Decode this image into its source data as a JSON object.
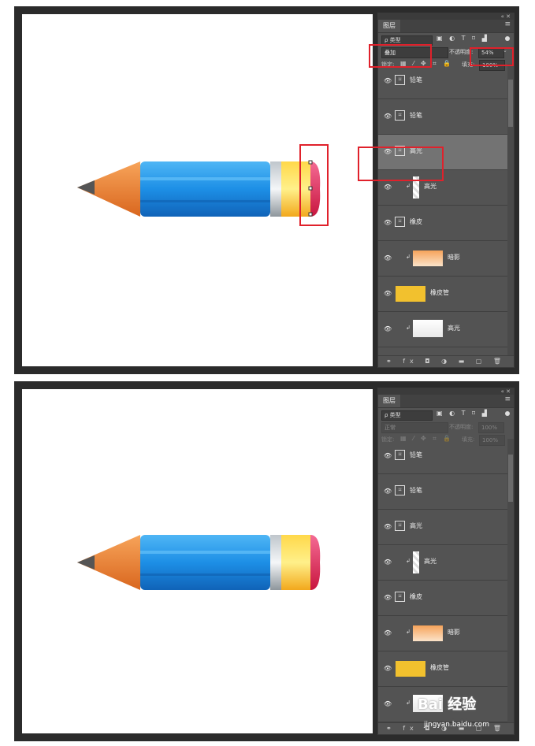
{
  "panel": {
    "tab_label": "图层",
    "filter_label": "ρ 类型",
    "filter_icons": "▣ ◐ T ⌑ ▟",
    "opacity_label": "不透明度:",
    "lock_label": "锁定:",
    "lock_icons": "▦ ⁄ ✥ ⌗ 🔒",
    "fill_label": "填充:",
    "footer_icons": "⚭ fx ◘ ◑ ▬ ▢ 🗑"
  },
  "top": {
    "blend_mode": "叠加",
    "opacity": "54%",
    "fill": "100%",
    "layers": [
      {
        "name": "铅笔",
        "kind": "group"
      },
      {
        "name": "铅笔",
        "kind": "group"
      },
      {
        "name": "高光",
        "kind": "group",
        "selected": true
      },
      {
        "name": "高光",
        "kind": "thumb-white-tall"
      },
      {
        "name": "橡皮",
        "kind": "group"
      },
      {
        "name": "暗影",
        "kind": "thumb-orange"
      },
      {
        "name": "橡皮管",
        "kind": "thumb-yellow"
      },
      {
        "name": "高光",
        "kind": "thumb-white"
      }
    ]
  },
  "bottom": {
    "blend_mode": "正常",
    "opacity": "100%",
    "fill": "100%",
    "layers": [
      {
        "name": "铅笔",
        "kind": "group"
      },
      {
        "name": "铅笔",
        "kind": "group"
      },
      {
        "name": "高光",
        "kind": "group"
      },
      {
        "name": "高光",
        "kind": "thumb-white-tall"
      },
      {
        "name": "橡皮",
        "kind": "group"
      },
      {
        "name": "暗影",
        "kind": "thumb-orange"
      },
      {
        "name": "橡皮管",
        "kind": "thumb-yellow"
      },
      {
        "name": "高光",
        "kind": "thumb-white"
      }
    ]
  },
  "watermark": {
    "text": "Bai 经验",
    "url": "jingyan.baidu.com"
  },
  "colors": {
    "highlight_box": "#e0212b",
    "pencil_blue": "#1f8fe0",
    "eraser_pink": "#e3225a"
  }
}
